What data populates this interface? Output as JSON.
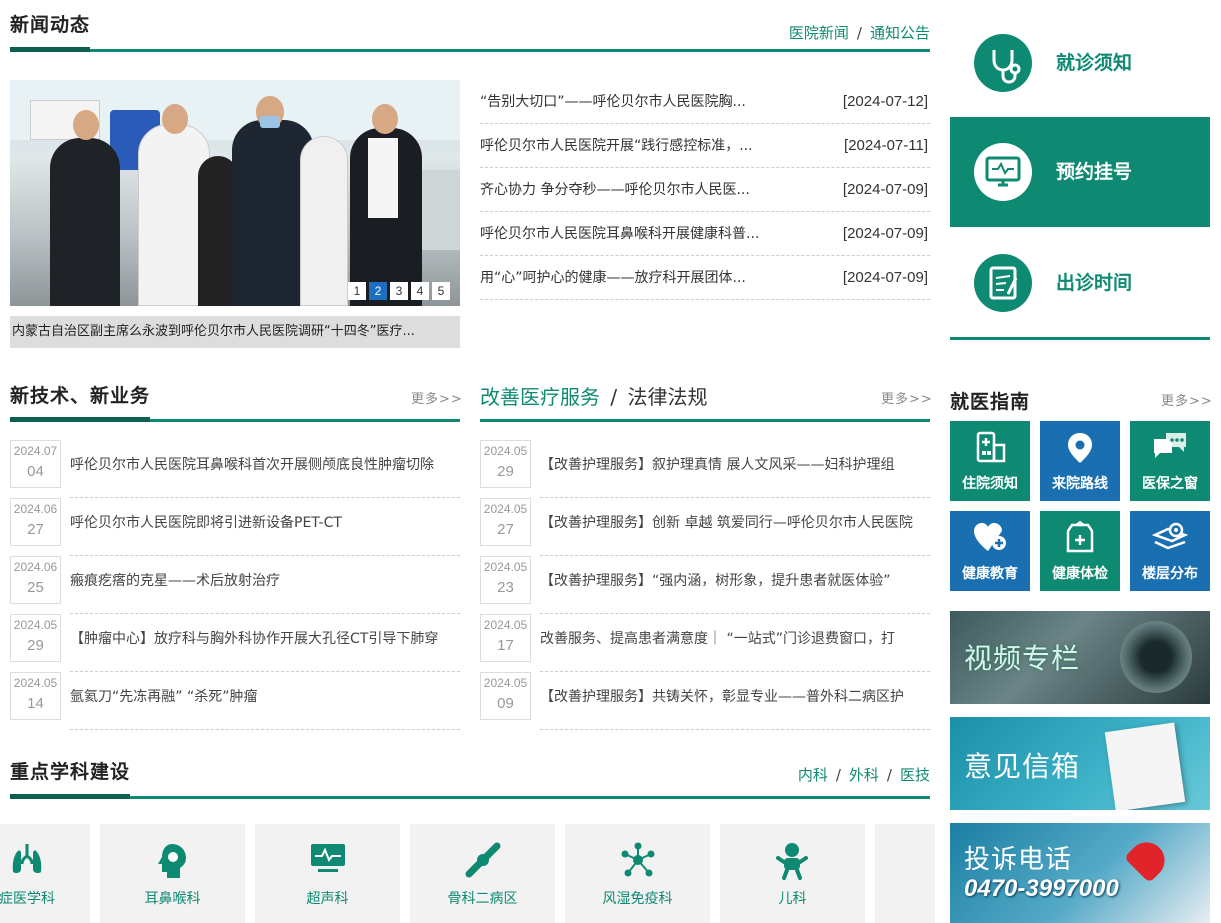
{
  "news": {
    "title": "新闻动态",
    "tabs": [
      "医院新闻",
      "通知公告"
    ],
    "items": [
      {
        "title": "“告别大切口”——呼伦贝尔市人民医院胸...",
        "date": "[2024-07-12]"
      },
      {
        "title": "呼伦贝尔市人民医院开展“践行感控标准，...",
        "date": "[2024-07-11]"
      },
      {
        "title": "齐心协力 争分夺秒——呼伦贝尔市人民医...",
        "date": "[2024-07-09]"
      },
      {
        "title": "呼伦贝尔市人民医院耳鼻喉科开展健康科普...",
        "date": "[2024-07-09]"
      },
      {
        "title": "用“心”呵护心的健康——放疗科开展团体...",
        "date": "[2024-07-09]"
      }
    ],
    "slide_caption": "内蒙古自治区副主席么永波到呼伦贝尔市人民医院调研“十四冬”医疗...",
    "pager": [
      "1",
      "2",
      "3",
      "4",
      "5"
    ],
    "pager_active_index": 1
  },
  "tech": {
    "title": "新技术、新业务",
    "more": "更多>>",
    "items": [
      {
        "ym": "2024.07",
        "d": "04",
        "title": "呼伦贝尔市人民医院耳鼻喉科首次开展侧颅底良性肿瘤切除"
      },
      {
        "ym": "2024.06",
        "d": "27",
        "title": "呼伦贝尔市人民医院即将引进新设备PET-CT"
      },
      {
        "ym": "2024.06",
        "d": "25",
        "title": "瘢痕疙瘩的克星——术后放射治疗"
      },
      {
        "ym": "2024.05",
        "d": "29",
        "title": "【肿瘤中心】放疗科与胸外科协作开展大孔径CT引导下肺穿"
      },
      {
        "ym": "2024.05",
        "d": "14",
        "title": "氩氦刀“先冻再融” “杀死”肿瘤"
      }
    ]
  },
  "service": {
    "title_active": "改善医疗服务",
    "sep": "/",
    "title_other": "法律法规",
    "more": "更多>>",
    "items": [
      {
        "ym": "2024.05",
        "d": "29",
        "title": "【改善护理服务】叙护理真情 展人文风采——妇科护理组"
      },
      {
        "ym": "2024.05",
        "d": "27",
        "title": "【改善护理服务】创新 卓越 筑爱同行—呼伦贝尔市人民医院"
      },
      {
        "ym": "2024.05",
        "d": "23",
        "title": "【改善护理服务】“强内涵，树形象，提升患者就医体验”"
      },
      {
        "ym": "2024.05",
        "d": "17",
        "title": "改善服务、提高患者满意度｜ “一站式”门诊退费窗口，打"
      },
      {
        "ym": "2024.05",
        "d": "09",
        "title": "【改善护理服务】共铸关怀，彰显专业——普外科二病区护"
      }
    ]
  },
  "disciplines": {
    "title": "重点学科建设",
    "tabs": [
      "内科",
      "外科",
      "医技"
    ],
    "items": [
      "重症医学科",
      "耳鼻喉科",
      "超声科",
      "骨科二病区",
      "风湿免疫科",
      "儿科"
    ]
  },
  "quick": [
    {
      "label": "就诊须知",
      "icon": "stethoscope-icon"
    },
    {
      "label": "预约挂号",
      "icon": "monitor-icon"
    },
    {
      "label": "出诊时间",
      "icon": "clipboard-icon"
    }
  ],
  "guide": {
    "title": "就医指南",
    "more": "更多>>",
    "tiles": [
      {
        "label": "住院须知",
        "color": "#0f8a72",
        "icon": "hospital-icon"
      },
      {
        "label": "来院路线",
        "color": "#1a6fb0",
        "icon": "location-pin-icon"
      },
      {
        "label": "医保之窗",
        "color": "#0f8a72",
        "icon": "chat-bubbles-icon"
      },
      {
        "label": "健康教育",
        "color": "#1a6fb0",
        "icon": "heart-plus-icon"
      },
      {
        "label": "健康体检",
        "color": "#0f8a72",
        "icon": "medical-check-icon"
      },
      {
        "label": "楼层分布",
        "color": "#1a6fb0",
        "icon": "floor-map-icon"
      }
    ]
  },
  "banners": [
    {
      "label": "视频专栏"
    },
    {
      "label": "意见信箱"
    },
    {
      "label": "投诉电话",
      "phone": "0470-3997000"
    }
  ],
  "colors": {
    "accent": "#0f8a72",
    "dark": "#0d5f50",
    "blue": "#1a6fb0"
  }
}
